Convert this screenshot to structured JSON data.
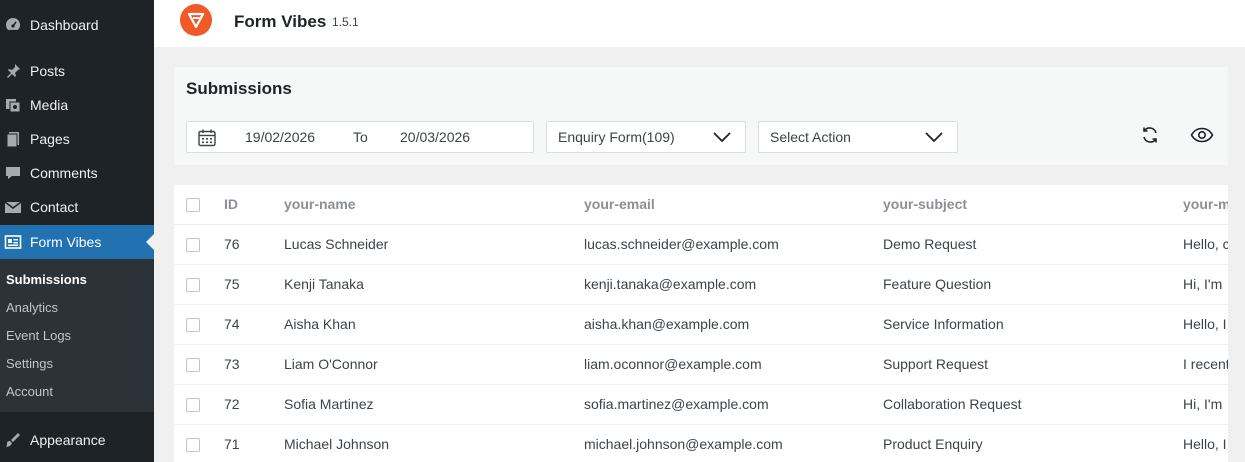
{
  "sidebar": {
    "items": [
      {
        "label": "Dashboard",
        "icon": "dashboard-icon"
      },
      {
        "label": "Posts",
        "icon": "pin-icon"
      },
      {
        "label": "Media",
        "icon": "media-icon"
      },
      {
        "label": "Pages",
        "icon": "pages-icon"
      },
      {
        "label": "Comments",
        "icon": "comment-icon"
      },
      {
        "label": "Contact",
        "icon": "mail-icon"
      },
      {
        "label": "Form Vibes",
        "icon": "form-icon"
      },
      {
        "label": "Appearance",
        "icon": "brush-icon"
      }
    ],
    "submenu": [
      {
        "label": "Submissions"
      },
      {
        "label": "Analytics"
      },
      {
        "label": "Event Logs"
      },
      {
        "label": "Settings"
      },
      {
        "label": "Account"
      }
    ]
  },
  "header": {
    "title": "Form Vibes",
    "version": "1.5.1",
    "brand_color": "#f05a28"
  },
  "panel": {
    "title": "Submissions",
    "date_from": "19/02/2026",
    "date_to_label": "To",
    "date_to": "20/03/2026",
    "form_select": "Enquiry Form(109)",
    "action_select": "Select Action"
  },
  "table": {
    "headers": [
      "ID",
      "your-name",
      "your-email",
      "your-subject",
      "your-m"
    ],
    "rows": [
      {
        "id": "76",
        "name": "Lucas Schneider",
        "email": "lucas.schneider@example.com",
        "subject": "Demo Request",
        "message": "Hello, c"
      },
      {
        "id": "75",
        "name": "Kenji Tanaka",
        "email": "kenji.tanaka@example.com",
        "subject": "Feature Question",
        "message": "Hi, I'm"
      },
      {
        "id": "74",
        "name": "Aisha Khan",
        "email": "aisha.khan@example.com",
        "subject": "Service Information",
        "message": "Hello, I"
      },
      {
        "id": "73",
        "name": "Liam O'Connor",
        "email": "liam.oconnor@example.com",
        "subject": "Support Request",
        "message": "I recent"
      },
      {
        "id": "72",
        "name": "Sofia Martinez",
        "email": "sofia.martinez@example.com",
        "subject": "Collaboration Request",
        "message": "Hi, I'm"
      },
      {
        "id": "71",
        "name": "Michael Johnson",
        "email": "michael.johnson@example.com",
        "subject": "Product Enquiry",
        "message": "Hello, I"
      }
    ]
  }
}
